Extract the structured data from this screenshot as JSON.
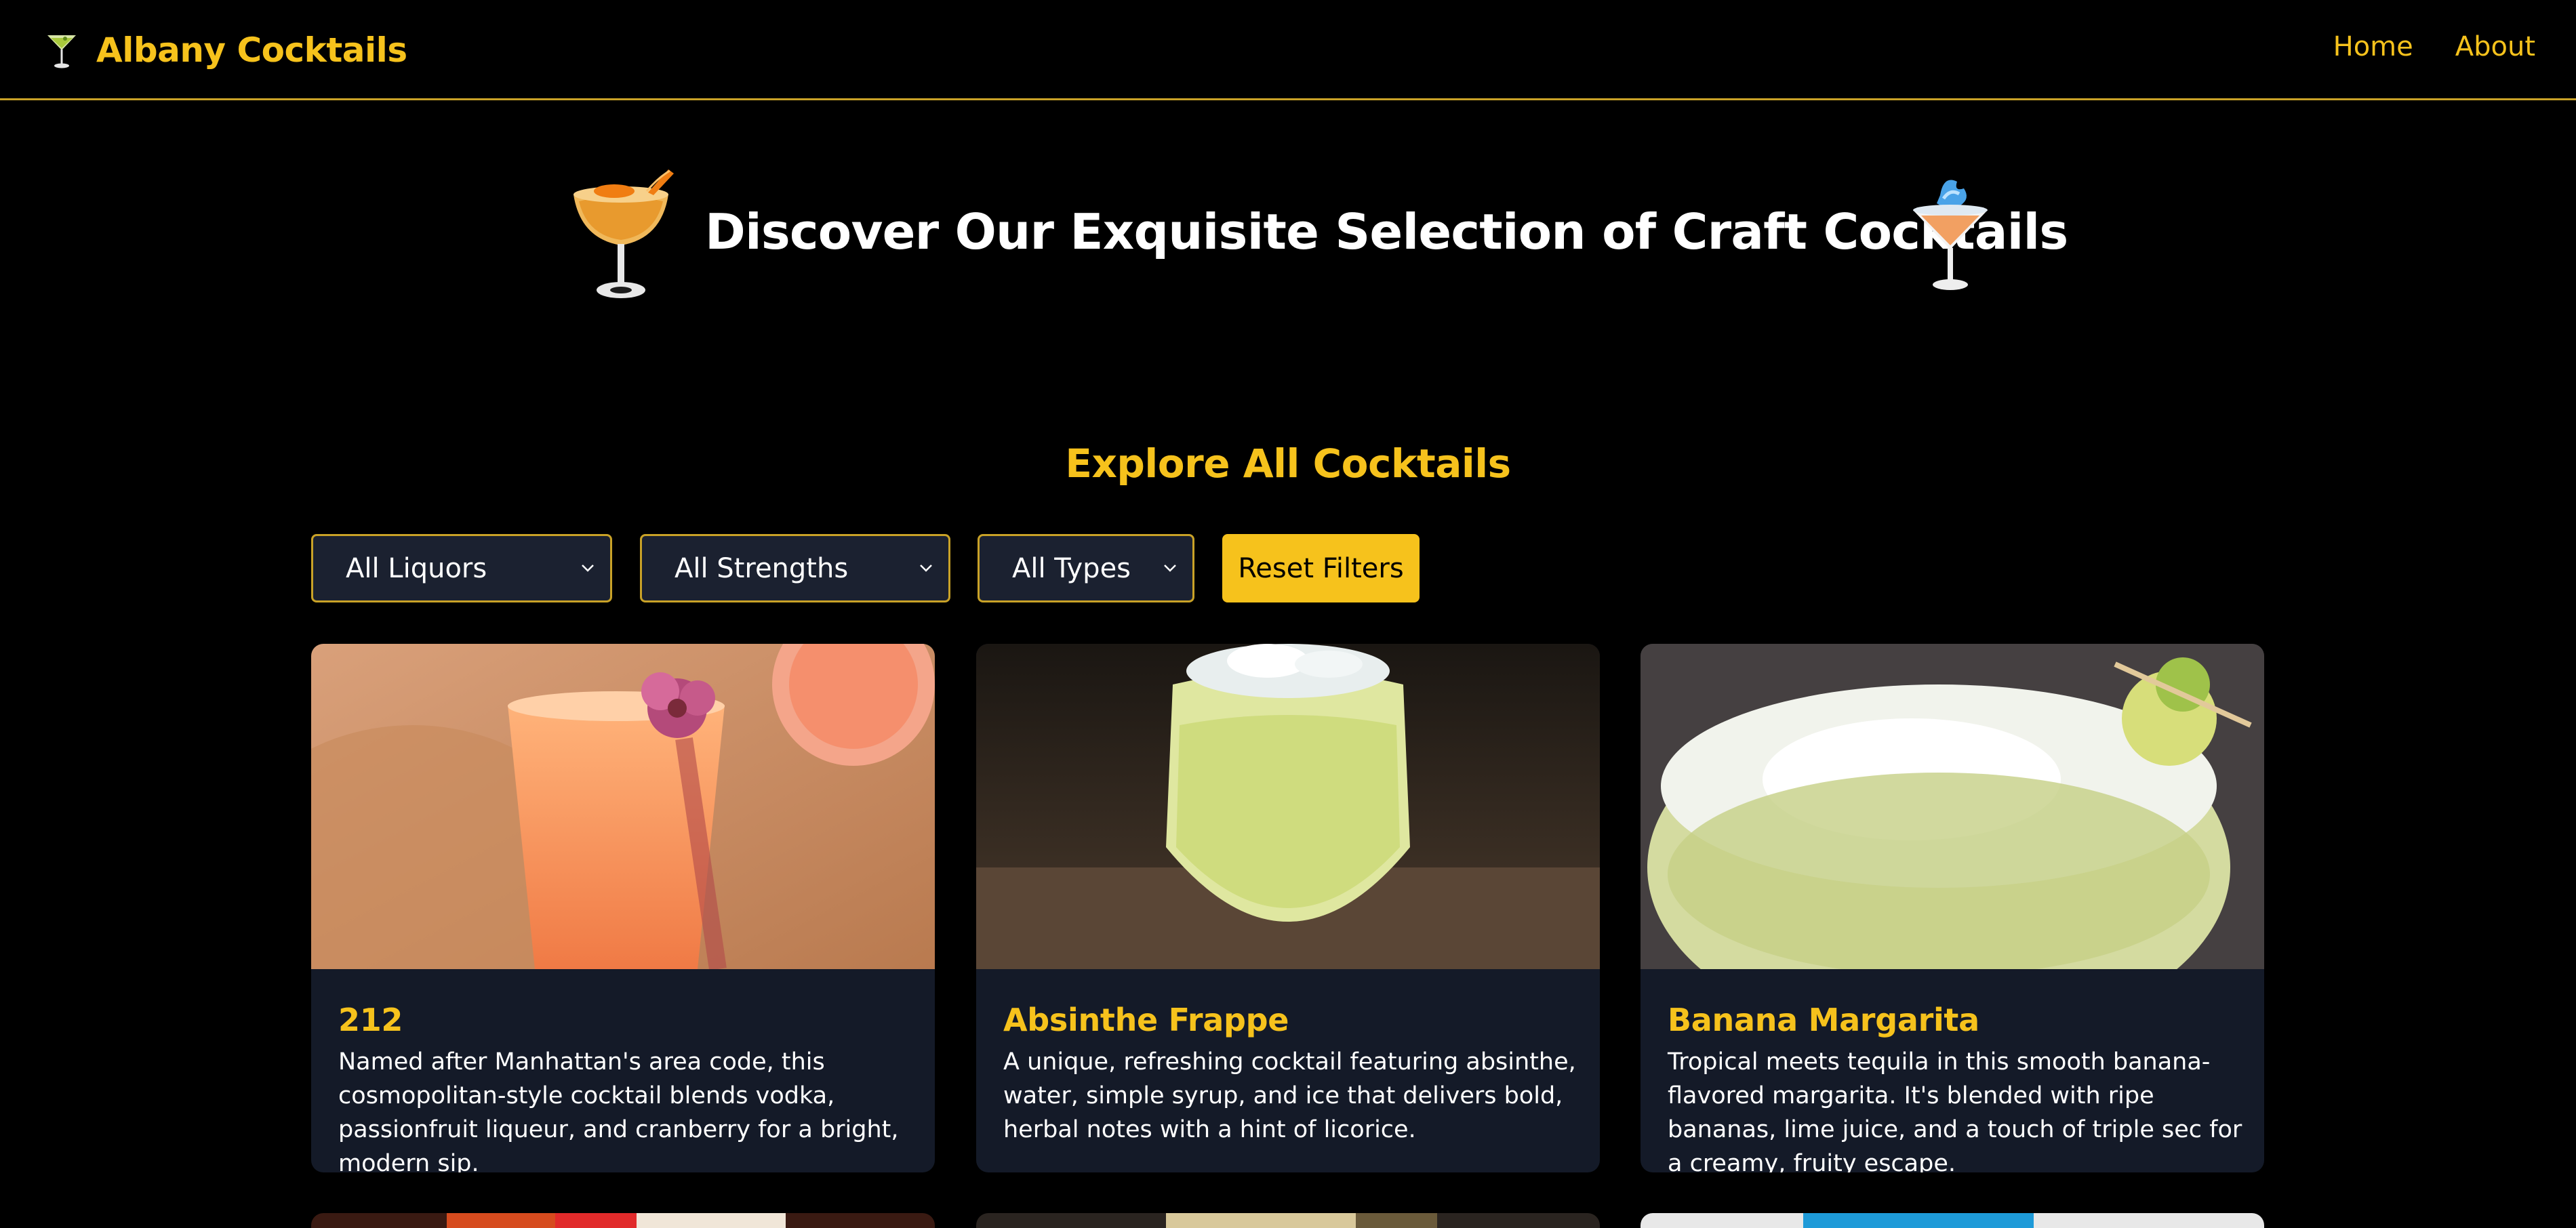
{
  "brand": {
    "name": "Albany Cocktails",
    "icon": "martini-glass-icon"
  },
  "nav": {
    "home": "Home",
    "about": "About"
  },
  "hero": {
    "title": "Discover Our Exquisite Selection of Craft Cocktails",
    "left_icon": "orange-cocktail-icon",
    "right_icon": "blue-cocktail-icon"
  },
  "section": {
    "title": "Explore All Cocktails"
  },
  "filters": {
    "liquor": "All Liquors",
    "strength": "All Strengths",
    "type": "All Types",
    "reset": "Reset Filters"
  },
  "cocktails": [
    {
      "name": "212",
      "description": "Named after Manhattan's area code, this cosmopolitan-style cocktail blends vodka, passionfruit liqueur, and cranberry for a bright, modern sip."
    },
    {
      "name": "Absinthe Frappe",
      "description": "A unique, refreshing cocktail featuring absinthe, water, simple syrup, and ice that delivers bold, herbal notes with a hint of licorice."
    },
    {
      "name": "Banana Margarita",
      "description": "Tropical meets tequila in this smooth banana-flavored margarita. It's blended with ripe bananas, lime juice, and a touch of triple sec for a creamy, fruity escape."
    }
  ],
  "colors": {
    "accent": "#f6c21c",
    "border": "#c9a227",
    "background": "#000000",
    "card": "#141a28",
    "filter_bg": "#1b2130"
  }
}
